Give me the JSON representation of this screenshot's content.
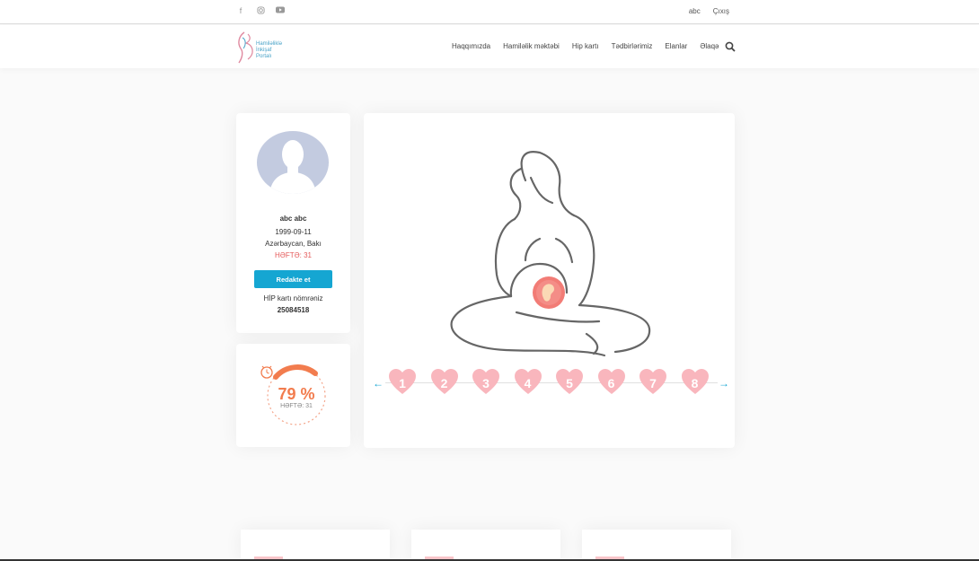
{
  "topbar": {
    "social": [
      "facebook-icon",
      "instagram-icon",
      "youtube-icon"
    ],
    "user_label": "abc",
    "logout_label": "Çıxış"
  },
  "header": {
    "logo_lines": [
      "Hamiləliklə",
      "İnkişaf",
      "Portalı"
    ],
    "nav": [
      "Haqqımızda",
      "Hamiləlik məktəbi",
      "Hip kartı",
      "Tədbirlərimiz",
      "Elanlar",
      "Əlaqə"
    ]
  },
  "profile": {
    "name": "abc abc",
    "birth": "1999-09-11",
    "location": "Azərbaycan, Bakı",
    "week": "HƏFTƏ: 31",
    "edit_label": "Redakte et",
    "hip_label": "HİP kartı nömrəniz",
    "hip_number": "25084518"
  },
  "progress": {
    "percent_label": "79 %",
    "percent": 79,
    "week_label": "HƏFTƏ: 31"
  },
  "weeks": [
    "1",
    "2",
    "3",
    "4",
    "5",
    "6",
    "7",
    "8"
  ],
  "colors": {
    "accent": "#15a6d2",
    "heart": "#f9b6bd",
    "orange": "#f27c4e",
    "week": "#e45a5a"
  }
}
